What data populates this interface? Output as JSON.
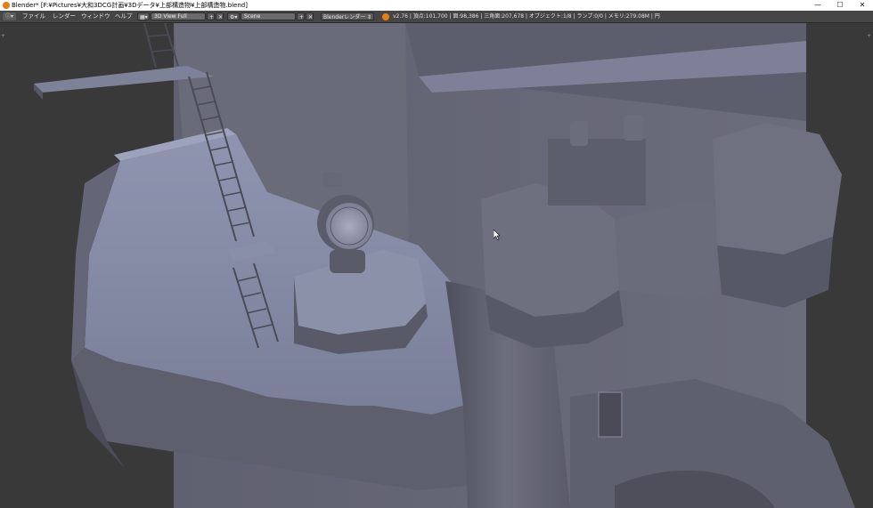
{
  "window": {
    "title": "Blender* [F:¥Pictures¥大和3DCG計画¥3Dデータ¥上部構造物¥上部構造物.blend]",
    "controls": {
      "minimize": "—",
      "maximize": "☐",
      "close": "✕"
    }
  },
  "menu": {
    "items": [
      "ファイル",
      "レンダー",
      "ウィンドウ",
      "ヘルプ"
    ]
  },
  "screen_layout": {
    "value": "3D View Full"
  },
  "scene": {
    "value": "Scene"
  },
  "render_engine": {
    "value": "Blenderレンダー"
  },
  "stats": {
    "text": "v2.76 | 頂点:101,700 | 面:98,386 | 三角面:207,678 | オブジェクト:1/8 | ランプ:0/0 | メモリ:279.08M | 円"
  },
  "colors": {
    "title_bg": "#ffffff",
    "header_bg": "#454545",
    "viewport_bg": "#393939",
    "model_gray": "#6c6d7c",
    "blender_orange": "#e87d0d"
  },
  "icons": [
    "blender-logo-icon",
    "editor-type-icon",
    "layout-icon",
    "scene-icon",
    "add-icon",
    "close-icon",
    "render-icon",
    "mouse-cursor-icon"
  ]
}
